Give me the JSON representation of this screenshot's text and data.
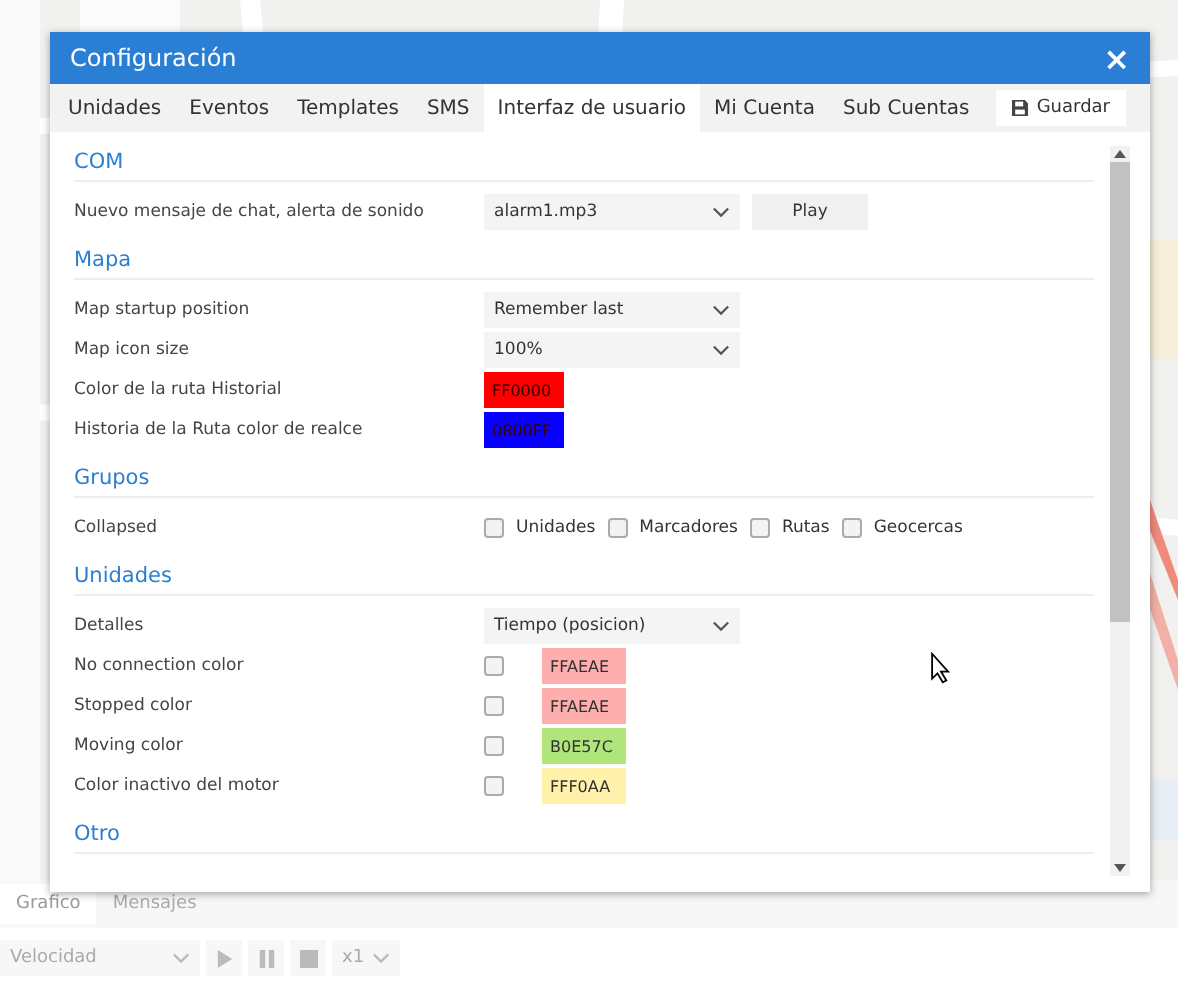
{
  "dialog": {
    "title": "Configuración",
    "close": "×"
  },
  "tabs": [
    {
      "label": "Unidades",
      "selected": false
    },
    {
      "label": "Eventos",
      "selected": false
    },
    {
      "label": "Templates",
      "selected": false
    },
    {
      "label": "SMS",
      "selected": false
    },
    {
      "label": "Interfaz de usuario",
      "selected": true
    },
    {
      "label": "Mi Cuenta",
      "selected": false
    },
    {
      "label": "Sub Cuentas",
      "selected": false
    }
  ],
  "save_button": "Guardar",
  "sections": [
    {
      "title": "COM",
      "rows": [
        {
          "kind": "select",
          "label": "Nuevo mensaje de chat, alerta de sonido",
          "value": "alarm1.mp3",
          "button": "Play"
        }
      ]
    },
    {
      "title": "Mapa",
      "rows": [
        {
          "kind": "select",
          "label": "Map startup position",
          "value": "Remember last"
        },
        {
          "kind": "select",
          "label": "Map icon size",
          "value": "100%"
        },
        {
          "kind": "color",
          "label": "Color de la ruta Historial",
          "value": "FF0000",
          "color": "#ff0000"
        },
        {
          "kind": "color",
          "label": "Historia de la Ruta color de realce",
          "value": "0800FF",
          "color": "#0800ff"
        }
      ]
    },
    {
      "title": "Grupos",
      "rows": [
        {
          "kind": "checks",
          "label": "Collapsed",
          "options": [
            {
              "label": "Unidades",
              "checked": false
            },
            {
              "label": "Marcadores",
              "checked": false
            },
            {
              "label": "Rutas",
              "checked": false
            },
            {
              "label": "Geocercas",
              "checked": false
            }
          ]
        }
      ]
    },
    {
      "title": "Unidades",
      "rows": [
        {
          "kind": "select",
          "label": "Detalles",
          "value": "Tiempo (posicion)"
        },
        {
          "kind": "check_color",
          "label": "No connection color",
          "checked": false,
          "value": "FFAEAE",
          "color": "#ffaeae"
        },
        {
          "kind": "check_color",
          "label": "Stopped color",
          "checked": false,
          "value": "FFAEAE",
          "color": "#ffaeae"
        },
        {
          "kind": "check_color",
          "label": "Moving color",
          "checked": false,
          "value": "B0E57C",
          "color": "#b0e57c"
        },
        {
          "kind": "check_color",
          "label": "Color inactivo del motor",
          "checked": false,
          "value": "FFF0AA",
          "color": "#fff0aa"
        }
      ]
    },
    {
      "title": "Otro"
    }
  ],
  "bottom_tabs": [
    {
      "label": "Grafico",
      "selected": true
    },
    {
      "label": "Mensajes",
      "selected": false
    }
  ],
  "player": {
    "sensor": "Velocidad",
    "speed": "x1"
  }
}
